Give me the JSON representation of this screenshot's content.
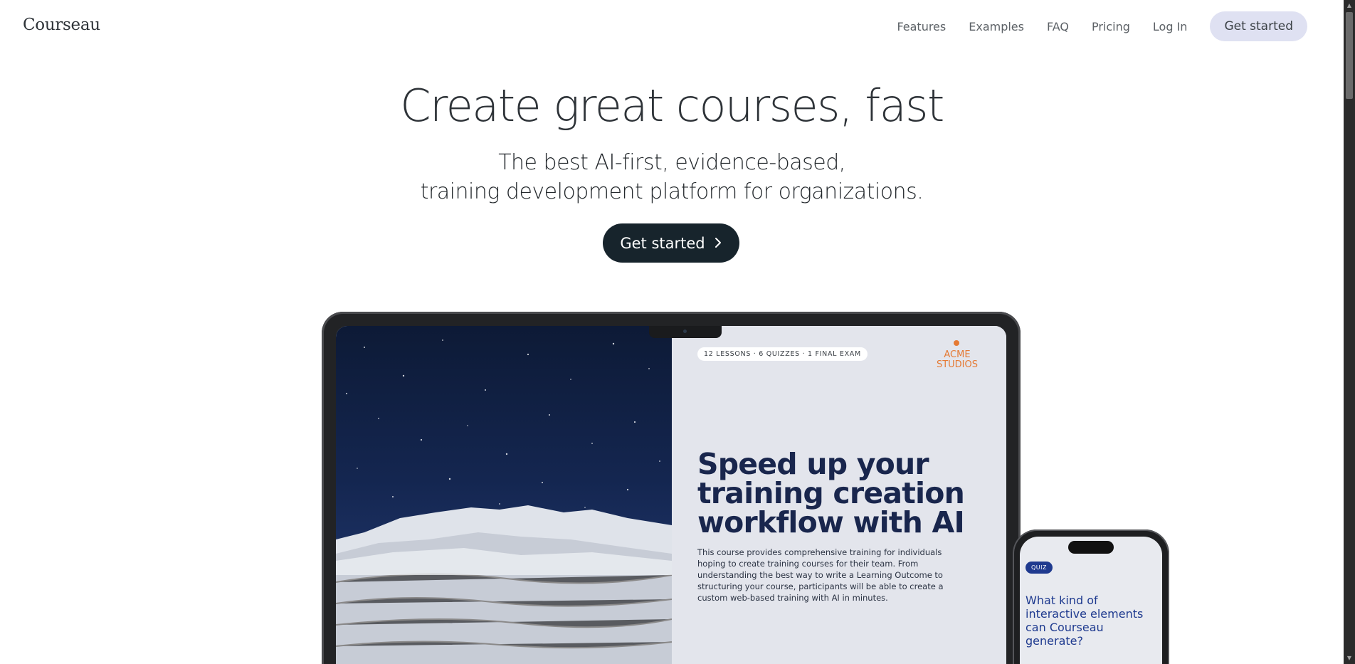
{
  "header": {
    "logo": "Courseau",
    "nav": [
      "Features",
      "Examples",
      "FAQ",
      "Pricing",
      "Log In"
    ],
    "cta": "Get started"
  },
  "hero": {
    "title": "Create great courses, fast",
    "subtitle_line1": "The best AI-first, evidence-based,",
    "subtitle_line2": "training development platform for organizations.",
    "cta": "Get started",
    "cta_icon": "chevron-right-icon"
  },
  "laptop_preview": {
    "pill": "12 LESSONS · 6 QUIZZES · 1 FINAL EXAM",
    "brand_line1": "ACME",
    "brand_line2": "STUDIOS",
    "title_line1": "Speed up your",
    "title_line2": "training creation",
    "title_line3": "workflow with AI",
    "description": "This course provides comprehensive training for individuals hoping to create training courses for their team. From understanding the best way to write a Learning Outcome to structuring your course, participants will be able to create a custom web-based training with AI in minutes."
  },
  "phone_preview": {
    "badge": "QUIZ",
    "question": "What kind of interactive elements can Courseau generate?"
  },
  "colors": {
    "cta_dark": "#17242c",
    "nav_cta_bg": "#dfe1f2",
    "brand_orange": "#e57a34",
    "course_title": "#19264d",
    "quiz_blue": "#1e3a8f"
  }
}
